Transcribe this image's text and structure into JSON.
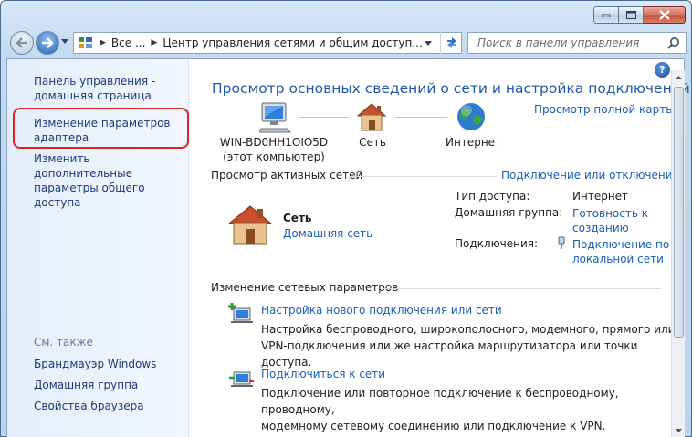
{
  "window": {
    "address_segments": [
      "Все ...",
      "Центр управления сетями и общим доступ..."
    ],
    "search_placeholder": "Поиск в панели управления"
  },
  "sidebar": {
    "home_link": [
      "Панель управления -",
      "домашняя страница"
    ],
    "adapter_link": [
      "Изменение параметров",
      "адаптера"
    ],
    "sharing_link": [
      "Изменить дополнительные",
      "параметры общего доступа"
    ],
    "see_also_label": "См. также",
    "see_also": [
      "Брандмауэр Windows",
      "Домашняя группа",
      "Свойства браузера"
    ]
  },
  "main": {
    "title": "Просмотр основных сведений о сети и настройка подключений",
    "full_map_link": "Просмотр полной карты",
    "map_nodes": {
      "computer": [
        "WIN-BD0HH1OIO5D",
        "(этот компьютер)"
      ],
      "network": "Сеть",
      "internet": "Интернет"
    },
    "active_networks": {
      "header": "Просмотр активных сетей",
      "connect_link": "Подключение или отключение",
      "network_name": "Сеть",
      "network_type_link": "Домашняя сеть",
      "access_type_label": "Тип доступа:",
      "access_type_value": "Интернет",
      "homegroup_label": "Домашняя группа:",
      "homegroup_link": [
        "Готовность к",
        "созданию"
      ],
      "connections_label": "Подключения:",
      "connections_link": [
        "Подключение по",
        "локальной сети"
      ]
    },
    "change_settings": {
      "header": "Изменение сетевых параметров",
      "tasks": [
        {
          "link": "Настройка нового подключения или сети",
          "desc": [
            "Настройка беспроводного, широкополосного, модемного, прямого или",
            "VPN-подключения или же настройка маршрутизатора или точки доступа."
          ]
        },
        {
          "link": "Подключиться к сети",
          "desc": [
            "Подключение или повторное подключение к беспроводному, проводному,",
            "модемному сетевому соединению или подключение к VPN."
          ]
        }
      ]
    },
    "help_glyph": "?"
  }
}
